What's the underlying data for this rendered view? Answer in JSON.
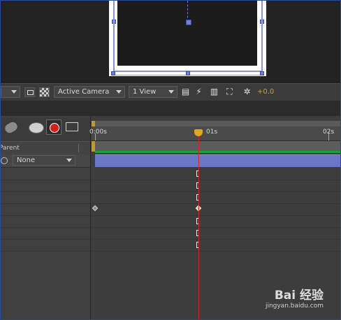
{
  "viewer_toolbar": {
    "camera_view": "Active Camera",
    "view_layout": "1 View",
    "exposure": "+0.0",
    "exposure_color": "#d6a21a"
  },
  "timeline": {
    "ruler_labels": [
      "0:00s",
      "01s",
      "02s"
    ],
    "parent_header": "Parent",
    "parent_value": "None",
    "playhead_color": "#cc2a2a",
    "layer_color": "#6a76c8",
    "keyframe_active_color": "#f0c020"
  },
  "icons": {
    "region_of_interest": "region-of-interest-icon",
    "transparency_grid": "transparency-grid-icon",
    "fast_preview": "fast-preview-icon",
    "reset_exposure": "reset-exposure-icon",
    "draft3d": "draft-3d-icon",
    "motion_blur": "motion-blur-icon",
    "graph_editor": "graph-editor-icon"
  },
  "watermark": {
    "brand": "Bai 经验",
    "url": "jingyan.baidu.com"
  }
}
